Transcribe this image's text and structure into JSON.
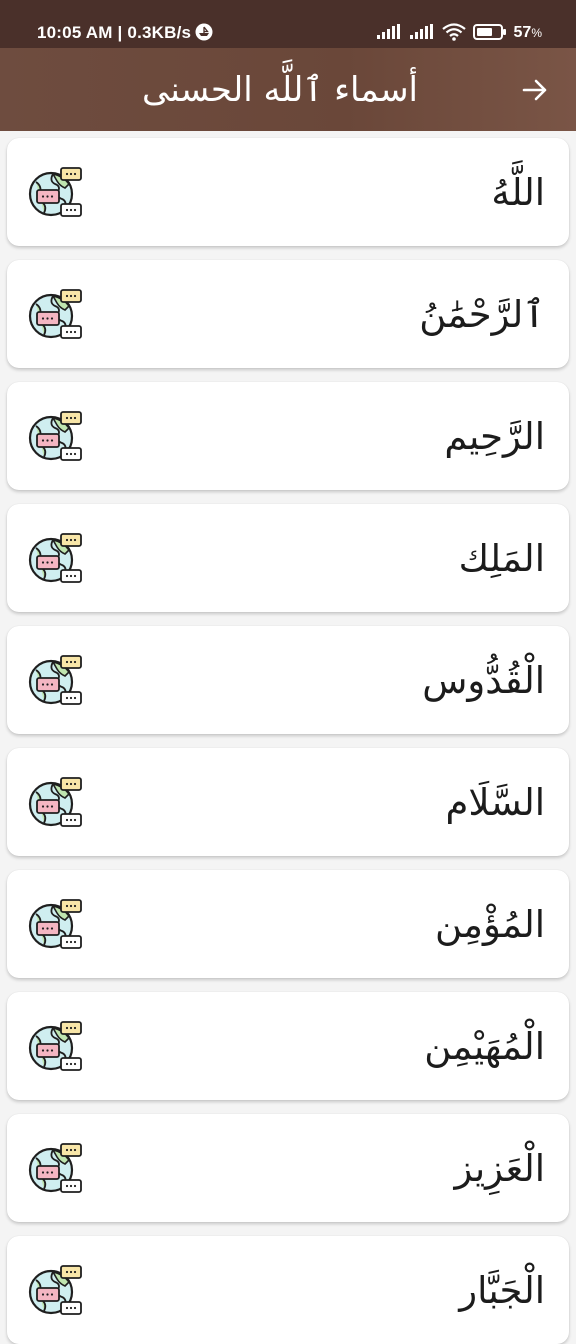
{
  "status_bar": {
    "text": "10:05 AM | 0.3KB/s",
    "battery": "57",
    "battery_unit": "%"
  },
  "toolbar": {
    "title": "أسماء ٱللَّه الحسنى",
    "back_icon": "arrow-right-icon"
  },
  "names": [
    {
      "name": "اللَّهُ"
    },
    {
      "name": "ٱلرَّحْمَٰنُ"
    },
    {
      "name": "الرَّحِيم"
    },
    {
      "name": "المَلِك"
    },
    {
      "name": "الْقُدُّوس"
    },
    {
      "name": "السَّلَام"
    },
    {
      "name": "المُؤْمِن"
    },
    {
      "name": "الْمُهَيْمِن"
    },
    {
      "name": "الْعَزِيز"
    },
    {
      "name": "الْجَبَّار"
    }
  ],
  "card_icon": "globe-translate-icon",
  "colors": {
    "status_bar": "#4a302a",
    "toolbar": "#6a4739",
    "background": "#f4f4f4",
    "card": "#ffffff"
  }
}
